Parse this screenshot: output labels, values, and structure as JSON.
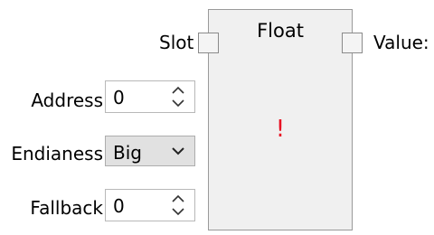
{
  "node": {
    "title": "Float",
    "error_glyph": "!",
    "input_port_label": "Slot",
    "output_port_label": "Value:"
  },
  "params": {
    "address": {
      "label": "Address",
      "value": "0"
    },
    "endianess": {
      "label": "Endianess",
      "value": "Big"
    },
    "fallback": {
      "label": "Fallback",
      "value": "0"
    }
  },
  "colors": {
    "error": "#e81123",
    "node_bg": "#f0f0f0",
    "select_bg": "#e1e1e1"
  }
}
